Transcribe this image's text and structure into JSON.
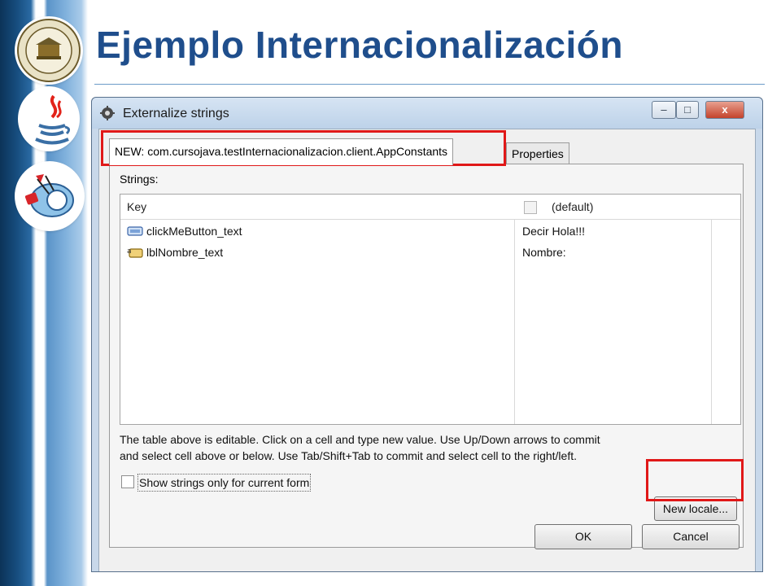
{
  "slide": {
    "title": "Ejemplo Internacionalización"
  },
  "dialog": {
    "title": "Externalize strings",
    "window_buttons": [
      "–",
      "□",
      "x"
    ],
    "tabs": [
      {
        "label": "NEW: com.cursojava.testInternacionalizacion.client.AppConstants",
        "active": true
      },
      {
        "label": "Properties",
        "active": false
      }
    ],
    "strings_label": "Strings:",
    "table": {
      "columns": [
        "Key",
        "(default)"
      ],
      "rows": [
        {
          "key": "clickMeButton_text",
          "default": "Decir Hola!!!",
          "icon": "button-widget-icon"
        },
        {
          "key": "lblNombre_text",
          "default": "Nombre:",
          "icon": "label-widget-icon"
        }
      ]
    },
    "help_text_1": "The table above is editable. Click on a cell and type new value. Use Up/Down arrows to commit",
    "help_text_2": "and select cell above or below. Use Tab/Shift+Tab to commit and select cell to the right/left.",
    "checkbox_label": "Show strings only for current form",
    "checkbox_checked": false,
    "new_locale_label": "New locale...",
    "ok_label": "OK",
    "cancel_label": "Cancel"
  },
  "colors": {
    "title": "#1f4e8c",
    "highlight": "#e01818",
    "sidebar_dark": "#0c3358"
  }
}
